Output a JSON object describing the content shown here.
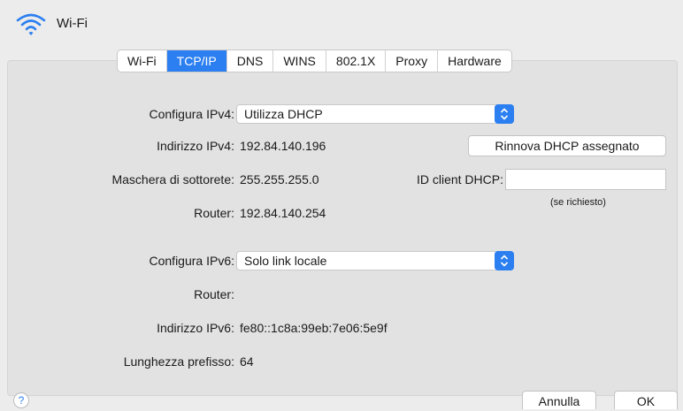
{
  "window": {
    "title": "Wi-Fi",
    "icon": "wifi-icon"
  },
  "tabs": [
    {
      "label": "Wi-Fi",
      "active": false
    },
    {
      "label": "TCP/IP",
      "active": true
    },
    {
      "label": "DNS",
      "active": false
    },
    {
      "label": "WINS",
      "active": false
    },
    {
      "label": "802.1X",
      "active": false
    },
    {
      "label": "Proxy",
      "active": false
    },
    {
      "label": "Hardware",
      "active": false
    }
  ],
  "ipv4": {
    "configure_label": "Configura IPv4:",
    "configure_value": "Utilizza DHCP",
    "address_label": "Indirizzo IPv4:",
    "address_value": "192.84.140.196",
    "subnet_label": "Maschera di sottorete:",
    "subnet_value": "255.255.255.0",
    "router_label": "Router:",
    "router_value": "192.84.140.254",
    "renew_button": "Rinnova DHCP assegnato",
    "dhcp_client_label": "ID client DHCP:",
    "dhcp_client_value": "",
    "dhcp_client_hint": "(se richiesto)"
  },
  "ipv6": {
    "configure_label": "Configura IPv6:",
    "configure_value": "Solo link locale",
    "router_label": "Router:",
    "router_value": "",
    "address_label": "Indirizzo IPv6:",
    "address_value": "fe80::1c8a:99eb:7e06:5e9f",
    "prefix_label": "Lunghezza prefisso:",
    "prefix_value": "64"
  },
  "footer": {
    "help": "?",
    "cancel": "Annulla",
    "ok": "OK"
  },
  "colors": {
    "accent": "#2b7ff0",
    "background": "#ececec",
    "panel": "#e2e2e2"
  }
}
